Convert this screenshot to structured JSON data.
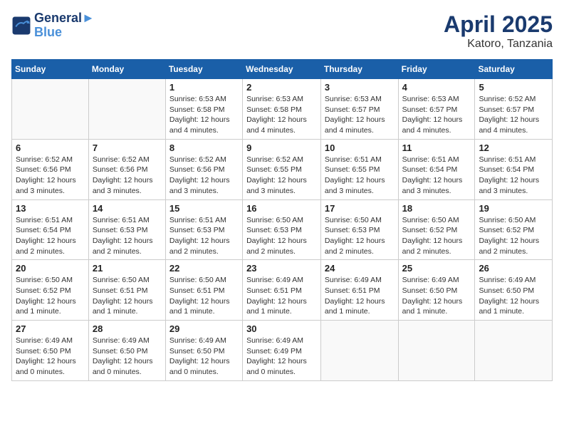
{
  "header": {
    "logo_line1": "General",
    "logo_line2": "Blue",
    "month_title": "April 2025",
    "location": "Katoro, Tanzania"
  },
  "weekdays": [
    "Sunday",
    "Monday",
    "Tuesday",
    "Wednesday",
    "Thursday",
    "Friday",
    "Saturday"
  ],
  "weeks": [
    [
      {
        "day": "",
        "info": ""
      },
      {
        "day": "",
        "info": ""
      },
      {
        "day": "1",
        "info": "Sunrise: 6:53 AM\nSunset: 6:58 PM\nDaylight: 12 hours\nand 4 minutes."
      },
      {
        "day": "2",
        "info": "Sunrise: 6:53 AM\nSunset: 6:58 PM\nDaylight: 12 hours\nand 4 minutes."
      },
      {
        "day": "3",
        "info": "Sunrise: 6:53 AM\nSunset: 6:57 PM\nDaylight: 12 hours\nand 4 minutes."
      },
      {
        "day": "4",
        "info": "Sunrise: 6:53 AM\nSunset: 6:57 PM\nDaylight: 12 hours\nand 4 minutes."
      },
      {
        "day": "5",
        "info": "Sunrise: 6:52 AM\nSunset: 6:57 PM\nDaylight: 12 hours\nand 4 minutes."
      }
    ],
    [
      {
        "day": "6",
        "info": "Sunrise: 6:52 AM\nSunset: 6:56 PM\nDaylight: 12 hours\nand 3 minutes."
      },
      {
        "day": "7",
        "info": "Sunrise: 6:52 AM\nSunset: 6:56 PM\nDaylight: 12 hours\nand 3 minutes."
      },
      {
        "day": "8",
        "info": "Sunrise: 6:52 AM\nSunset: 6:56 PM\nDaylight: 12 hours\nand 3 minutes."
      },
      {
        "day": "9",
        "info": "Sunrise: 6:52 AM\nSunset: 6:55 PM\nDaylight: 12 hours\nand 3 minutes."
      },
      {
        "day": "10",
        "info": "Sunrise: 6:51 AM\nSunset: 6:55 PM\nDaylight: 12 hours\nand 3 minutes."
      },
      {
        "day": "11",
        "info": "Sunrise: 6:51 AM\nSunset: 6:54 PM\nDaylight: 12 hours\nand 3 minutes."
      },
      {
        "day": "12",
        "info": "Sunrise: 6:51 AM\nSunset: 6:54 PM\nDaylight: 12 hours\nand 3 minutes."
      }
    ],
    [
      {
        "day": "13",
        "info": "Sunrise: 6:51 AM\nSunset: 6:54 PM\nDaylight: 12 hours\nand 2 minutes."
      },
      {
        "day": "14",
        "info": "Sunrise: 6:51 AM\nSunset: 6:53 PM\nDaylight: 12 hours\nand 2 minutes."
      },
      {
        "day": "15",
        "info": "Sunrise: 6:51 AM\nSunset: 6:53 PM\nDaylight: 12 hours\nand 2 minutes."
      },
      {
        "day": "16",
        "info": "Sunrise: 6:50 AM\nSunset: 6:53 PM\nDaylight: 12 hours\nand 2 minutes."
      },
      {
        "day": "17",
        "info": "Sunrise: 6:50 AM\nSunset: 6:53 PM\nDaylight: 12 hours\nand 2 minutes."
      },
      {
        "day": "18",
        "info": "Sunrise: 6:50 AM\nSunset: 6:52 PM\nDaylight: 12 hours\nand 2 minutes."
      },
      {
        "day": "19",
        "info": "Sunrise: 6:50 AM\nSunset: 6:52 PM\nDaylight: 12 hours\nand 2 minutes."
      }
    ],
    [
      {
        "day": "20",
        "info": "Sunrise: 6:50 AM\nSunset: 6:52 PM\nDaylight: 12 hours\nand 1 minute."
      },
      {
        "day": "21",
        "info": "Sunrise: 6:50 AM\nSunset: 6:51 PM\nDaylight: 12 hours\nand 1 minute."
      },
      {
        "day": "22",
        "info": "Sunrise: 6:50 AM\nSunset: 6:51 PM\nDaylight: 12 hours\nand 1 minute."
      },
      {
        "day": "23",
        "info": "Sunrise: 6:49 AM\nSunset: 6:51 PM\nDaylight: 12 hours\nand 1 minute."
      },
      {
        "day": "24",
        "info": "Sunrise: 6:49 AM\nSunset: 6:51 PM\nDaylight: 12 hours\nand 1 minute."
      },
      {
        "day": "25",
        "info": "Sunrise: 6:49 AM\nSunset: 6:50 PM\nDaylight: 12 hours\nand 1 minute."
      },
      {
        "day": "26",
        "info": "Sunrise: 6:49 AM\nSunset: 6:50 PM\nDaylight: 12 hours\nand 1 minute."
      }
    ],
    [
      {
        "day": "27",
        "info": "Sunrise: 6:49 AM\nSunset: 6:50 PM\nDaylight: 12 hours\nand 0 minutes."
      },
      {
        "day": "28",
        "info": "Sunrise: 6:49 AM\nSunset: 6:50 PM\nDaylight: 12 hours\nand 0 minutes."
      },
      {
        "day": "29",
        "info": "Sunrise: 6:49 AM\nSunset: 6:50 PM\nDaylight: 12 hours\nand 0 minutes."
      },
      {
        "day": "30",
        "info": "Sunrise: 6:49 AM\nSunset: 6:49 PM\nDaylight: 12 hours\nand 0 minutes."
      },
      {
        "day": "",
        "info": ""
      },
      {
        "day": "",
        "info": ""
      },
      {
        "day": "",
        "info": ""
      }
    ]
  ]
}
